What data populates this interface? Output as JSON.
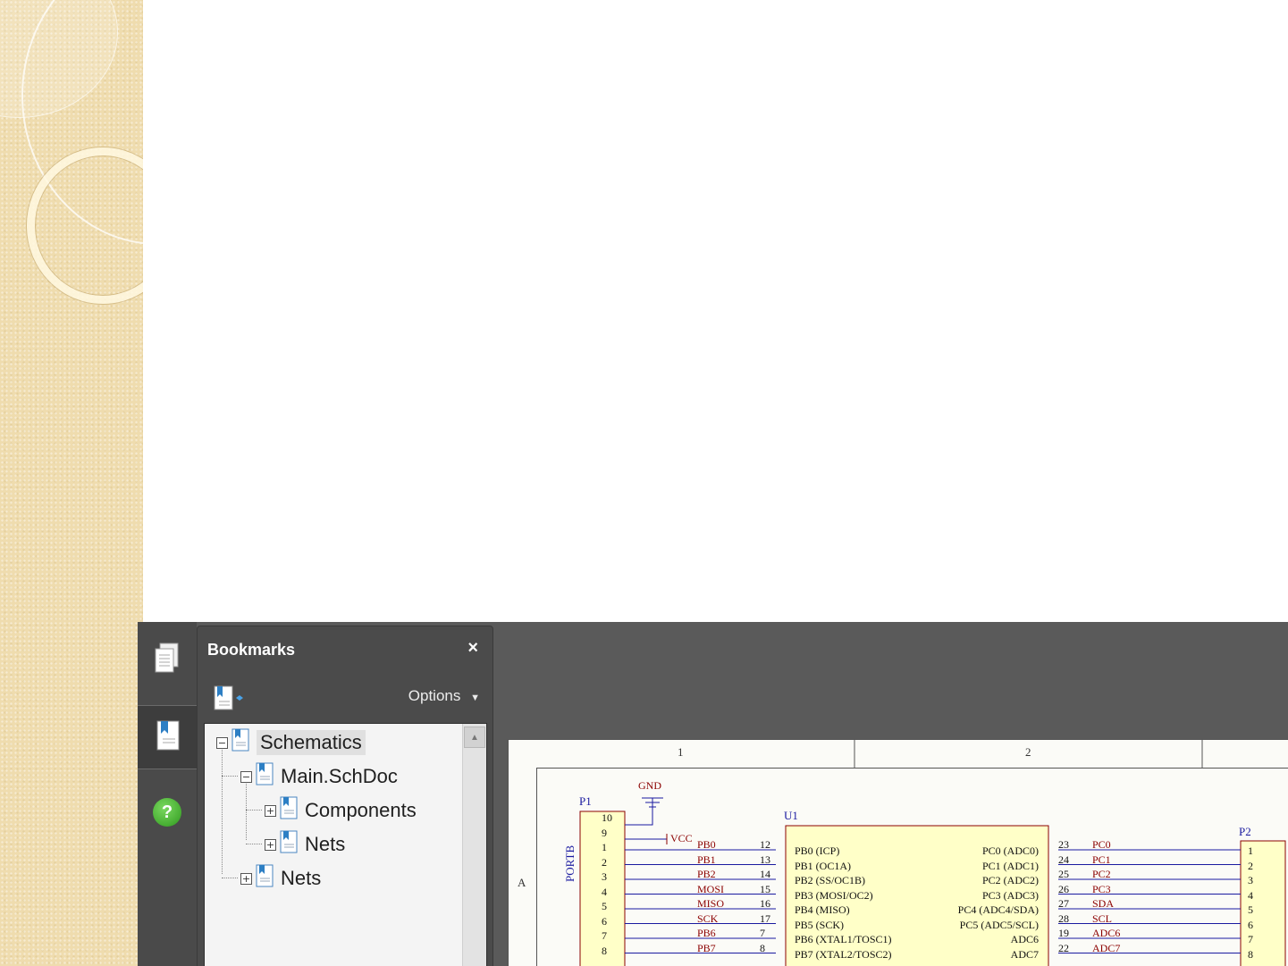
{
  "bookmarks_panel": {
    "title": "Bookmarks",
    "close_label": "×",
    "options_label": "Options",
    "tree": [
      {
        "label": "Schematics",
        "toggle": "−",
        "selected": true
      },
      {
        "label": "Main.SchDoc",
        "toggle": "−"
      },
      {
        "label": "Components",
        "toggle": "+"
      },
      {
        "label": "Nets",
        "toggle": "+"
      },
      {
        "label": "Nets",
        "toggle": "+"
      }
    ]
  },
  "left_rail": {
    "icons": [
      "pages-icon",
      "bookmarks-icon",
      "help-icon"
    ],
    "help_glyph": "?"
  },
  "colors": {
    "accent_help": "#3cae2a",
    "bookmark_blue": "#2d7fc4",
    "net_red": "#8b0000",
    "component_fill": "#ffffc8"
  },
  "schematic": {
    "zone_columns": [
      "1",
      "2"
    ],
    "zone_rows": [
      "A"
    ],
    "connector_left": {
      "designator": "P1",
      "side_label": "PORTB",
      "pins": [
        "10",
        "9",
        "1",
        "2",
        "3",
        "4",
        "5",
        "6",
        "7",
        "8"
      ]
    },
    "power": {
      "gnd": "GND",
      "vcc": "VCC"
    },
    "left_nets": [
      "PB0",
      "PB1",
      "PB2",
      "MOSI",
      "MISO",
      "SCK",
      "PB6",
      "PB7"
    ],
    "mcu": {
      "designator": "U1",
      "left_pin_numbers": [
        "12",
        "13",
        "14",
        "15",
        "16",
        "17",
        "7",
        "8"
      ],
      "left_pins": [
        "PB0 (ICP)",
        "PB1 (OC1A)",
        "PB2 (SS/OC1B)",
        "PB3 (MOSI/OC2)",
        "PB4 (MISO)",
        "PB5 (SCK)",
        "PB6 (XTAL1/TOSC1)",
        "PB7 (XTAL2/TOSC2)"
      ],
      "right_pins": [
        "PC0 (ADC0)",
        "PC1 (ADC1)",
        "PC2 (ADC2)",
        "PC3 (ADC3)",
        "PC4 (ADC4/SDA)",
        "PC5 (ADC5/SCL)",
        "ADC6",
        "ADC7"
      ],
      "right_pin_numbers": [
        "23",
        "24",
        "25",
        "26",
        "27",
        "28",
        "19",
        "22"
      ]
    },
    "right_nets": [
      "PC0",
      "PC1",
      "PC2",
      "PC3",
      "SDA",
      "SCL",
      "ADC6",
      "ADC7"
    ],
    "connector_right": {
      "designator": "P2",
      "pins": [
        "1",
        "2",
        "3",
        "4",
        "5",
        "6",
        "7",
        "8"
      ]
    }
  }
}
